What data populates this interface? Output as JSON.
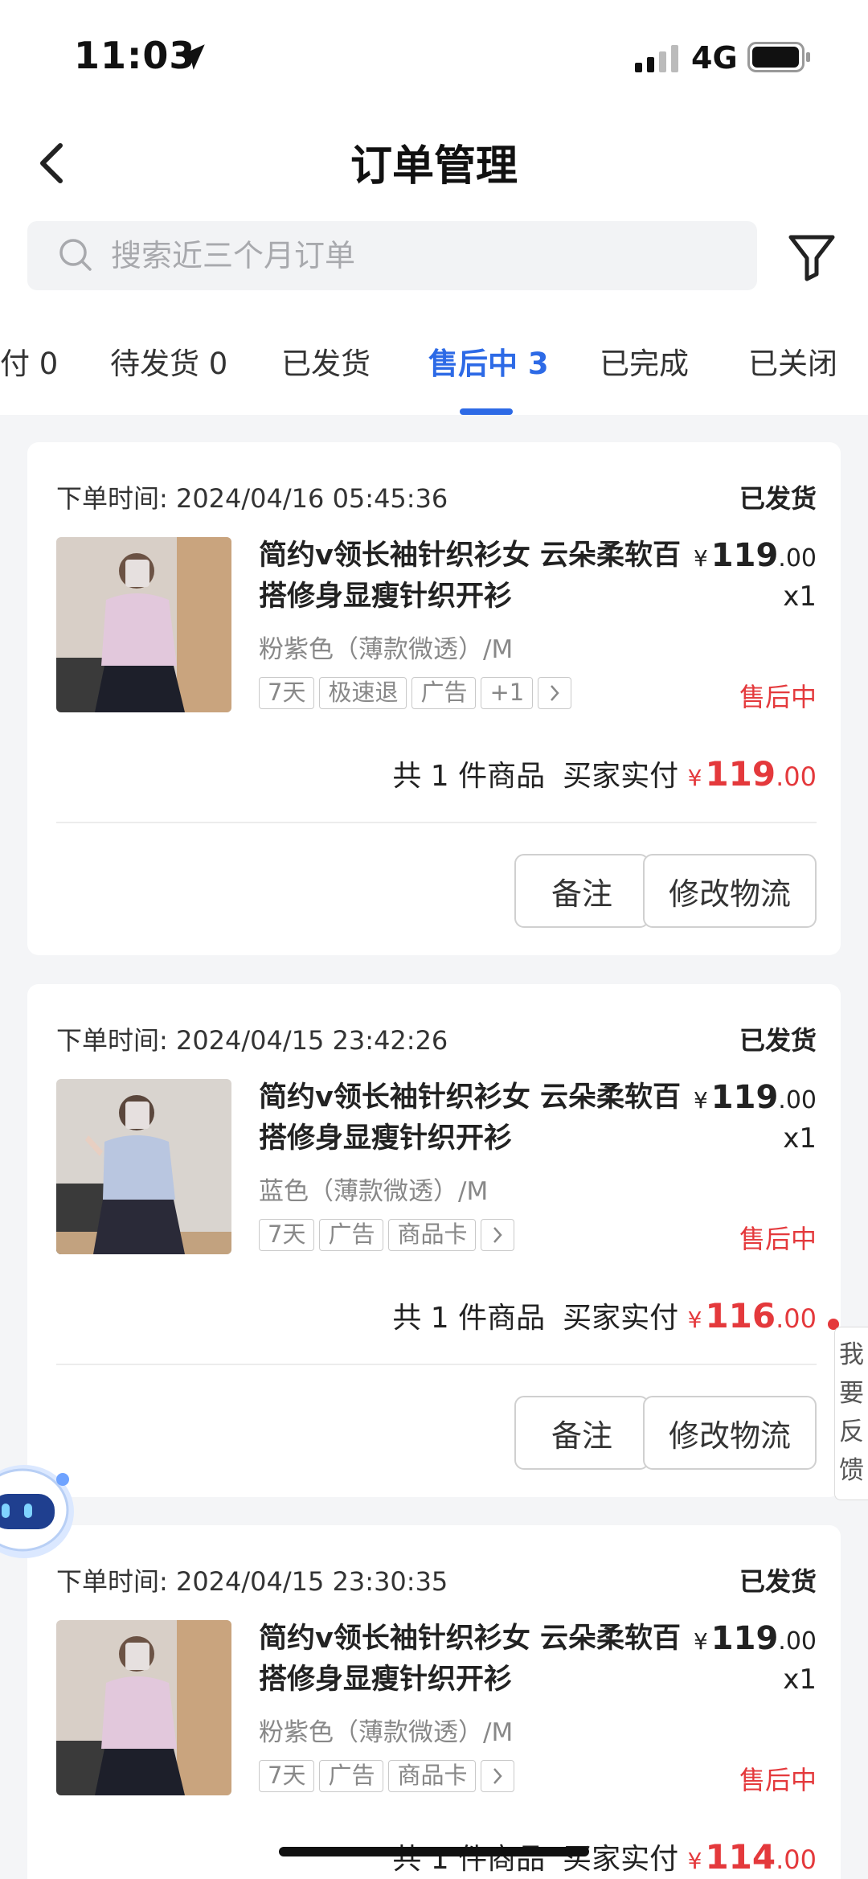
{
  "status_bar": {
    "time": "11:03",
    "network": "4G"
  },
  "header": {
    "title": "订单管理"
  },
  "search": {
    "placeholder": "搜索近三个月订单"
  },
  "tabs": [
    {
      "label": "付 0"
    },
    {
      "label": "待发货 0"
    },
    {
      "label": "已发货"
    },
    {
      "label": "售后中 3",
      "active": true
    },
    {
      "label": "已完成"
    },
    {
      "label": "已关闭"
    }
  ],
  "orders": [
    {
      "time": "下单时间: 2024/04/16 05:45:36",
      "status": "已发货",
      "title": "简约v领长袖针织衫女 云朵柔软百搭修身显瘦针织开衫",
      "price_yen": "¥",
      "price_int": "119",
      "price_dec": ".00",
      "qty": "x1",
      "sku": "粉紫色（薄款微透）/M",
      "tags": [
        "7天",
        "极速退",
        "广告",
        "+1"
      ],
      "after_sale": "售后中",
      "count_label": "共 1 件商品",
      "paid_label": "买家实付",
      "paid_yen": "¥",
      "paid_int": "119",
      "paid_dec": ".00",
      "btn_remark": "备注",
      "btn_logistics": "修改物流"
    },
    {
      "time": "下单时间: 2024/04/15 23:42:26",
      "status": "已发货",
      "title": "简约v领长袖针织衫女 云朵柔软百搭修身显瘦针织开衫",
      "price_yen": "¥",
      "price_int": "119",
      "price_dec": ".00",
      "qty": "x1",
      "sku": "蓝色（薄款微透）/M",
      "tags": [
        "7天",
        "广告",
        "商品卡"
      ],
      "after_sale": "售后中",
      "count_label": "共 1 件商品",
      "paid_label": "买家实付",
      "paid_yen": "¥",
      "paid_int": "116",
      "paid_dec": ".00",
      "btn_remark": "备注",
      "btn_logistics": "修改物流"
    },
    {
      "time": "下单时间: 2024/04/15 23:30:35",
      "status": "已发货",
      "title": "简约v领长袖针织衫女 云朵柔软百搭修身显瘦针织开衫",
      "price_yen": "¥",
      "price_int": "119",
      "price_dec": ".00",
      "qty": "x1",
      "sku": "粉紫色（薄款微透）/M",
      "tags": [
        "7天",
        "广告",
        "商品卡"
      ],
      "after_sale": "售后中",
      "count_label": "共 1 件商品",
      "paid_label": "买家实付",
      "paid_yen": "¥",
      "paid_int": "114",
      "paid_dec": ".00",
      "btn_remark": "备注",
      "btn_logistics": "修改物流"
    }
  ],
  "feedback": {
    "label": "我要反馈"
  },
  "colors": {
    "accent": "#2d6ae6",
    "price_red": "#e4393c",
    "background": "#f4f5f7"
  }
}
